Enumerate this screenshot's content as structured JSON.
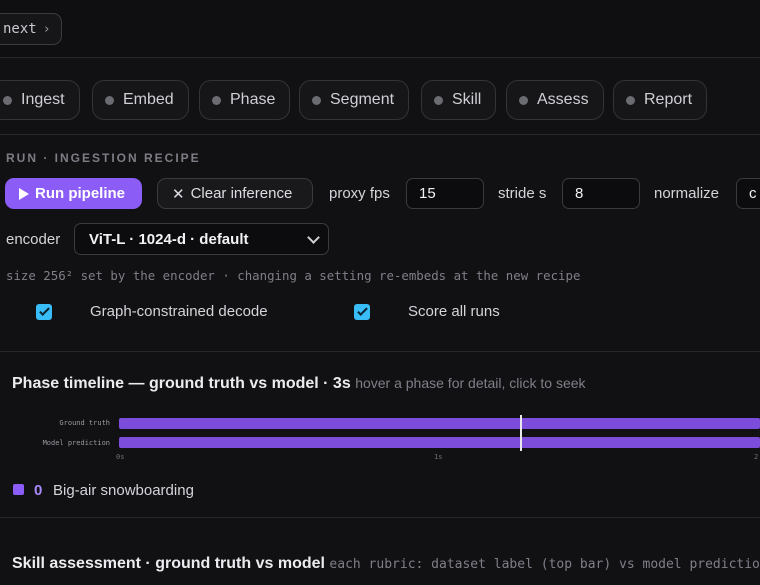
{
  "topbar": {
    "next_label": "next",
    "next_icon": "chevron-right-icon"
  },
  "tabs": [
    {
      "label": "Ingest"
    },
    {
      "label": "Embed"
    },
    {
      "label": "Phase"
    },
    {
      "label": "Segment"
    },
    {
      "label": "Skill"
    },
    {
      "label": "Assess"
    },
    {
      "label": "Report"
    }
  ],
  "recipe": {
    "section_label": "RUN · INGESTION RECIPE",
    "run_label": "Run pipeline",
    "clear_label": "Clear inference",
    "proxy_fps_label": "proxy fps",
    "proxy_fps_value": "15",
    "stride_label": "stride s",
    "stride_value": "8",
    "normalize_label": "normalize",
    "normalize_value": "c",
    "encoder_label": "encoder",
    "encoder_value": "ViT-L · 1024-d · default",
    "hint": "size 256² set by the encoder · changing a setting re-embeds at the new recipe",
    "graph_decode_label": "Graph-constrained decode",
    "graph_decode_checked": true,
    "score_all_label": "Score all runs",
    "score_all_checked": true
  },
  "timeline": {
    "title": "Phase timeline — ground truth vs model · 3s",
    "subtitle": "hover a phase for detail, click to seek",
    "tracks": [
      {
        "label": "Ground truth"
      },
      {
        "label": "Model prediction"
      }
    ],
    "axis_ticks": [
      "0s",
      "1s",
      "2"
    ],
    "cursor_seconds": 1.25,
    "phase_color": "#8b5cf6",
    "legend": {
      "index": "0",
      "name": "Big-air snowboarding"
    }
  },
  "skill": {
    "title": "Skill assessment · ground truth vs model",
    "subtitle": "each rubric: dataset label (top bar) vs model prediction (bo"
  },
  "colors": {
    "accent": "#8b5cf6",
    "checkbox": "#38bdf8",
    "background": "#121214"
  }
}
